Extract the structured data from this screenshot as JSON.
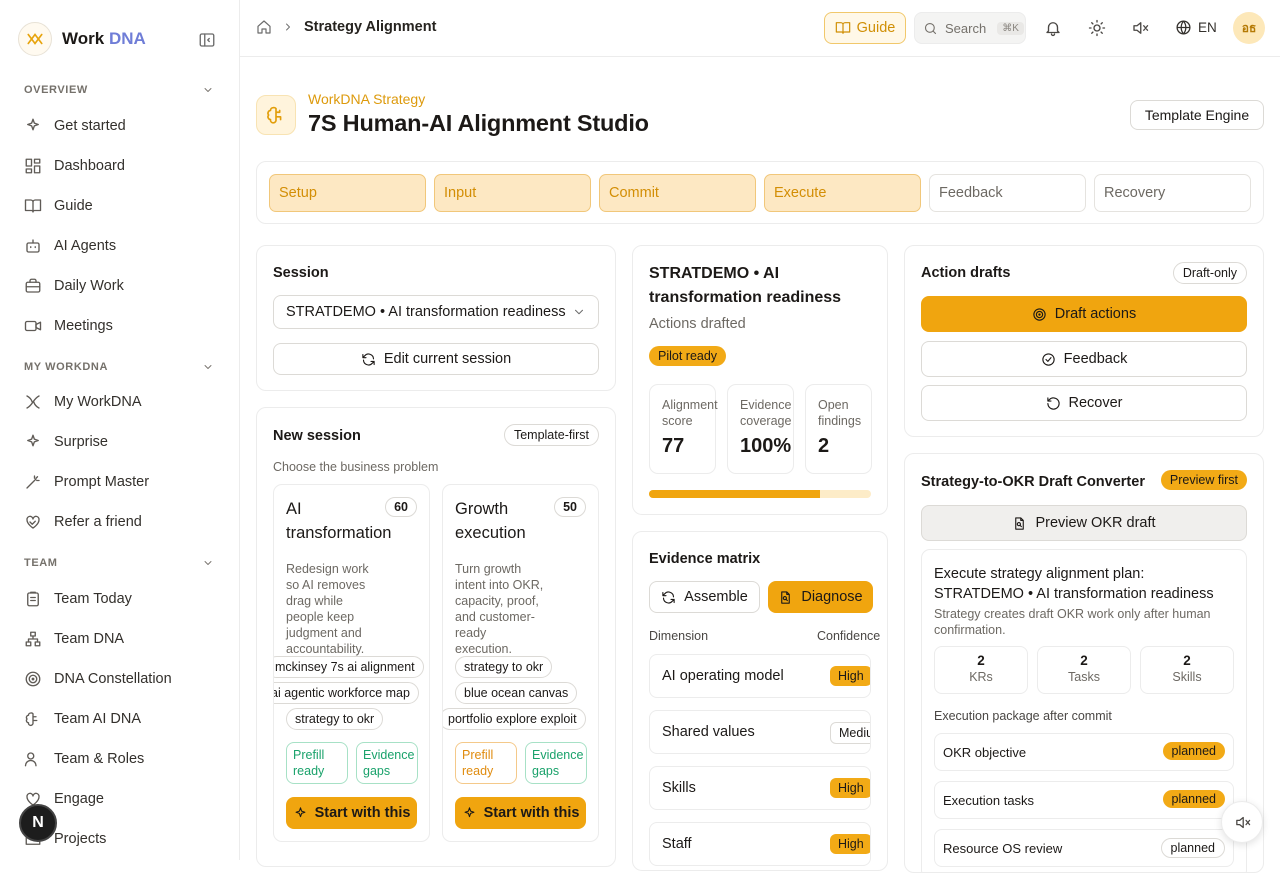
{
  "brand": {
    "name": "Work",
    "accent": "DNA"
  },
  "sidebar": {
    "sections": [
      {
        "label": "OVERVIEW",
        "items": [
          {
            "label": "Get started",
            "icon": "sparkles-icon"
          },
          {
            "label": "Dashboard",
            "icon": "dashboard-icon"
          },
          {
            "label": "Guide",
            "icon": "book-icon"
          },
          {
            "label": "AI Agents",
            "icon": "robot-icon"
          },
          {
            "label": "Daily Work",
            "icon": "briefcase-icon"
          },
          {
            "label": "Meetings",
            "icon": "video-icon"
          }
        ]
      },
      {
        "label": "MY WORKDNA",
        "items": [
          {
            "label": "My WorkDNA",
            "icon": "dna-icon"
          },
          {
            "label": "Surprise",
            "icon": "sparkles-icon"
          },
          {
            "label": "Prompt Master",
            "icon": "wand-icon"
          },
          {
            "label": "Refer a friend",
            "icon": "heart-handshake-icon"
          }
        ]
      },
      {
        "label": "TEAM",
        "items": [
          {
            "label": "Team Today",
            "icon": "clipboard-icon"
          },
          {
            "label": "Team DNA",
            "icon": "network-icon"
          },
          {
            "label": "DNA Constellation",
            "icon": "target-icon"
          },
          {
            "label": "Team AI DNA",
            "icon": "brain-icon"
          },
          {
            "label": "Team & Roles",
            "icon": "users-icon"
          },
          {
            "label": "Engage",
            "icon": "heart-icon"
          },
          {
            "label": "Projects",
            "icon": "folder-icon"
          }
        ]
      }
    ],
    "user_initial": "N"
  },
  "topbar": {
    "breadcrumb": "Strategy Alignment",
    "guide": "Guide",
    "search": "Search",
    "shortcut": "⌘K",
    "language": "EN",
    "user_initials": "อธ"
  },
  "header": {
    "eyebrow": "WorkDNA Strategy",
    "title": "7S Human-AI Alignment Studio",
    "template_button": "Template Engine"
  },
  "steps": [
    {
      "label": "Setup",
      "active": true
    },
    {
      "label": "Input",
      "active": true
    },
    {
      "label": "Commit",
      "active": true
    },
    {
      "label": "Execute",
      "active": true
    },
    {
      "label": "Feedback",
      "active": false
    },
    {
      "label": "Recovery",
      "active": false
    }
  ],
  "session": {
    "title": "Session",
    "selected": "STRATDEMO • AI transformation readiness",
    "edit": "Edit current session"
  },
  "new_session": {
    "title": "New session",
    "badge": "Template-first",
    "subtitle": "Choose the business problem",
    "options": [
      {
        "title": "AI transformation",
        "score": "60",
        "desc": "Redesign work so AI removes drag while people keep judgment and accountability.",
        "tags": [
          "mckinsey 7s ai alignment",
          "ai agentic workforce map",
          "strategy to okr"
        ],
        "prefill": "Prefill ready",
        "evidence": "Evidence gaps",
        "cta": "Start with this"
      },
      {
        "title": "Growth execution",
        "score": "50",
        "desc": "Turn growth intent into OKR, capacity, proof, and customer-ready execution.",
        "tags": [
          "strategy to okr",
          "blue ocean canvas",
          "portfolio explore exploit"
        ],
        "prefill": "Prefill ready",
        "evidence": "Evidence gaps",
        "cta": "Start with this"
      }
    ]
  },
  "summary": {
    "title": "STRATDEMO • AI transformation readiness",
    "status": "Actions drafted",
    "badge": "Pilot ready",
    "stats": [
      {
        "label": "Alignment score",
        "value": "77"
      },
      {
        "label": "Evidence coverage",
        "value": "100%"
      },
      {
        "label": "Open findings",
        "value": "2"
      }
    ],
    "progress": 0.77
  },
  "evidence": {
    "title": "Evidence matrix",
    "assemble": "Assemble",
    "diagnose": "Diagnose",
    "col_dimension": "Dimension",
    "col_confidence": "Confidence",
    "rows": [
      {
        "dimension": "AI operating model",
        "level": "High"
      },
      {
        "dimension": "Shared values",
        "level": "Medium"
      },
      {
        "dimension": "Skills",
        "level": "High"
      },
      {
        "dimension": "Staff",
        "level": "High"
      }
    ]
  },
  "actions": {
    "title": "Action drafts",
    "badge": "Draft-only",
    "draft": "Draft actions",
    "feedback": "Feedback",
    "recover": "Recover"
  },
  "okr": {
    "title": "Strategy-to-OKR Draft Converter",
    "badge": "Preview first",
    "preview": "Preview OKR draft",
    "plan_title": "Execute strategy alignment plan: STRATDEMO • AI transformation readiness",
    "plan_desc": "Strategy creates draft OKR work only after human confirmation.",
    "counts": [
      {
        "value": "2",
        "label": "KRs"
      },
      {
        "value": "2",
        "label": "Tasks"
      },
      {
        "value": "2",
        "label": "Skills"
      }
    ],
    "package_label": "Execution package after commit",
    "package": [
      {
        "label": "OKR objective",
        "status": "planned"
      },
      {
        "label": "Execution tasks",
        "status": "planned"
      },
      {
        "label": "Resource OS review",
        "status": "planned"
      }
    ]
  },
  "colors": {
    "accent": "#f0a50f",
    "accent_soft": "#fde8c3",
    "brand_dna": "#6f7dd7"
  }
}
